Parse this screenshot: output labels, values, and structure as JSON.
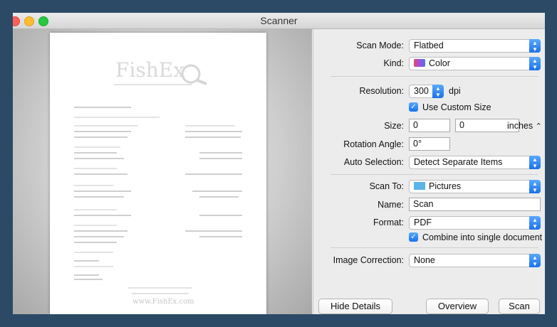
{
  "window": {
    "title": "Scanner"
  },
  "settings": {
    "scan_mode": {
      "label": "Scan Mode:",
      "value": "Flatbed"
    },
    "kind": {
      "label": "Kind:",
      "value": "Color"
    },
    "resolution": {
      "label": "Resolution:",
      "value": "300",
      "unit": "dpi"
    },
    "use_custom_size": {
      "label": "Use Custom Size",
      "checked": true
    },
    "size": {
      "label": "Size:",
      "width": "0",
      "height": "0",
      "unit": "inches"
    },
    "rotation_angle": {
      "label": "Rotation Angle:",
      "value": "0°"
    },
    "auto_selection": {
      "label": "Auto Selection:",
      "value": "Detect Separate Items"
    },
    "scan_to": {
      "label": "Scan To:",
      "value": "Pictures"
    },
    "name": {
      "label": "Name:",
      "value": "Scan"
    },
    "format": {
      "label": "Format:",
      "value": "PDF"
    },
    "combine": {
      "label": "Combine into single document",
      "checked": true
    },
    "image_correction": {
      "label": "Image Correction:",
      "value": "None"
    }
  },
  "buttons": {
    "hide_details": "Hide Details",
    "overview": "Overview",
    "scan": "Scan"
  },
  "preview_doc": {
    "logo": "FishEx",
    "footer_line": "www.FishEx.com"
  },
  "colors": {
    "accent": "#1a73e8",
    "titlebar": "#d6d6d6",
    "background": "#2c4a66"
  },
  "icons": {
    "traffic_lights": [
      "close",
      "minimize",
      "zoom"
    ],
    "stepper": "up-down-chevrons-icon"
  }
}
